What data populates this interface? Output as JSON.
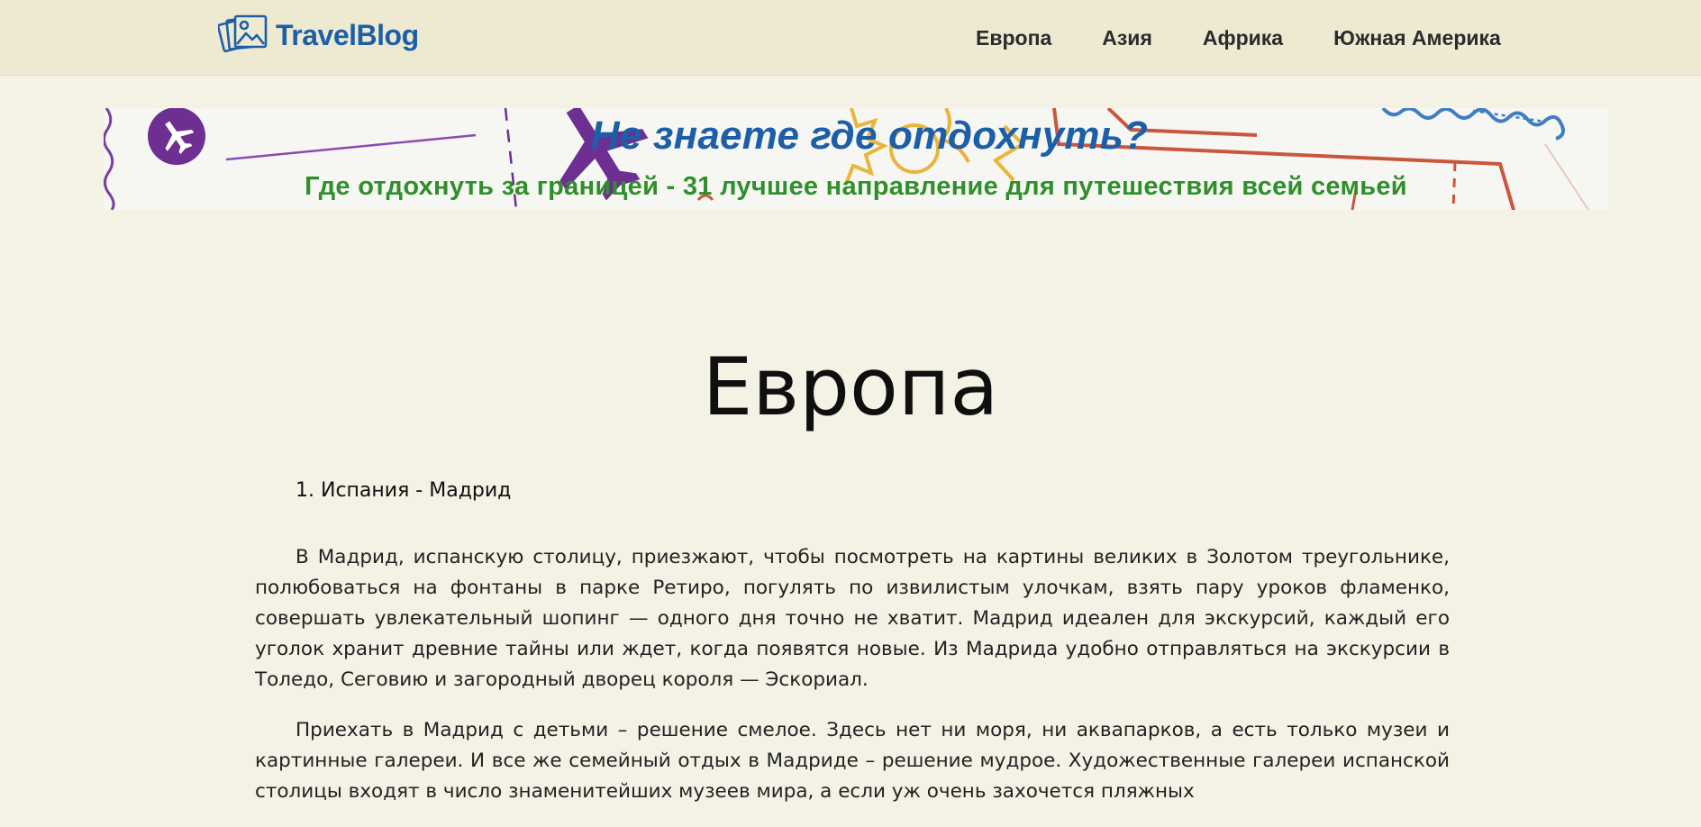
{
  "header": {
    "logo_text": "TravelBlog",
    "logo_icon": "photo-album-icon",
    "nav": [
      "Европа",
      "Азия",
      "Африка",
      "Южная Америка"
    ]
  },
  "banner": {
    "title": "Не знаете где отдохнуть?",
    "subtitle": "Где отдохнуть за границей - 31 лучшее направление для путешествия всей семьей"
  },
  "main": {
    "title": "Европа",
    "section_heading": "1. Испания - Мадрид",
    "paragraphs": [
      "В Мадрид, испанскую столицу, приезжают, чтобы посмотреть на картины великих в Золотом треугольнике, полюбоваться на фонтаны в парке Ретиро, погулять по извилистым улочкам, взять пару уроков фламенко, совершать увлекательный шопинг — одного дня точно не хватит. Мадрид идеален для экскурсий, каждый его уголок хранит древние тайны или ждет, когда появятся новые. Из Мадрида удобно отправляться на экскурсии в Толедо, Сеговию и загородный дворец короля — Эскориал.",
      "Приехать в Мадрид с детьми – решение смелое. Здесь нет ни моря, ни аквапарков, а есть только музеи и картинные галереи. И все же семейный отдых в Мадриде – решение мудрое. Художественные галереи испанской столицы входят в число знаменитейших музеев мира, а если уж очень захочется пляжных"
    ]
  },
  "colors": {
    "header_bg": "#eeead1",
    "page_bg": "#f3f2e5",
    "brand_blue": "#1c5fa8",
    "subtitle_green": "#2f8f2a"
  }
}
